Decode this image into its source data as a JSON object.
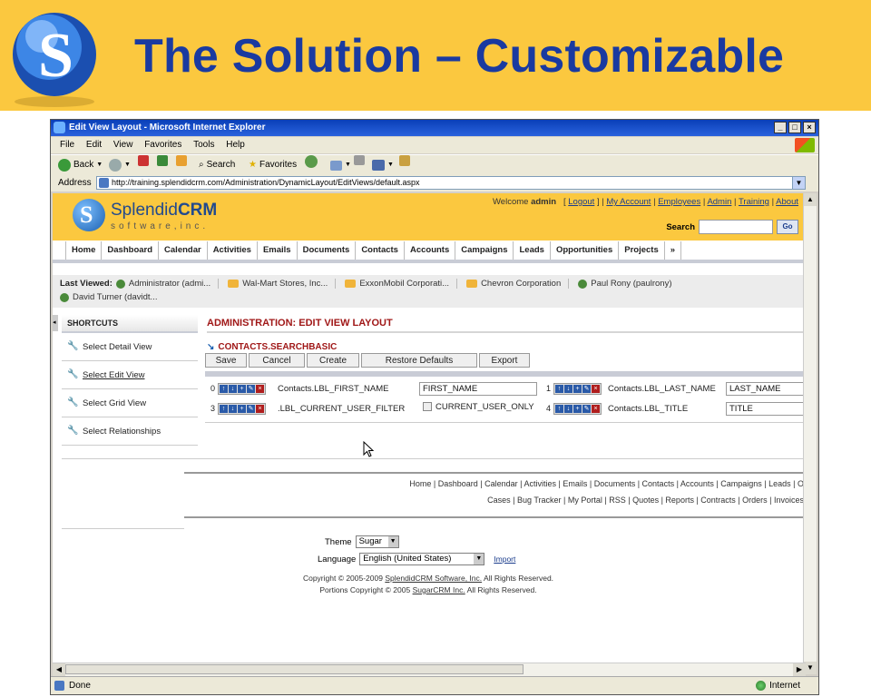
{
  "slide": {
    "title": "The Solution – Customizable"
  },
  "browser": {
    "window_title": "Edit View Layout - Microsoft Internet Explorer",
    "menu": [
      "File",
      "Edit",
      "View",
      "Favorites",
      "Tools",
      "Help"
    ],
    "toolbar": {
      "back": "Back",
      "search": "Search",
      "favorites": "Favorites"
    },
    "address_label": "Address",
    "url": "http://training.splendidcrm.com/Administration/DynamicLayout/EditViews/default.aspx",
    "status_text": "Done",
    "zone": "Internet"
  },
  "crm": {
    "brand_main": "Splendid",
    "brand_bold": "CRM",
    "brand_sub": "software,inc.",
    "welcome_prefix": "Welcome",
    "welcome_user": "admin",
    "top_links": [
      "Logout",
      "My Account",
      "Employees",
      "Admin",
      "Training",
      "About"
    ],
    "search_label": "Search",
    "search_go": "Go",
    "tabs": [
      "Home",
      "Dashboard",
      "Calendar",
      "Activities",
      "Emails",
      "Documents",
      "Contacts",
      "Accounts",
      "Campaigns",
      "Leads",
      "Opportunities",
      "Projects",
      "»"
    ],
    "last_viewed_label": "Last Viewed:",
    "last_viewed": [
      {
        "label": "Administrator (admi...",
        "icon": "user-icon"
      },
      {
        "label": "Wal-Mart Stores, Inc...",
        "icon": "folder-icon"
      },
      {
        "label": "ExxonMobil Corporati...",
        "icon": "folder-icon"
      },
      {
        "label": "Chevron Corporation",
        "icon": "folder-icon"
      },
      {
        "label": "Paul Rony (paulrony)",
        "icon": "user-icon"
      }
    ],
    "last_viewed_row2": "David Turner (davidt...",
    "shortcuts_title": "SHORTCUTS",
    "shortcuts": [
      "Select Detail View",
      "Select Edit View",
      "Select Grid View",
      "Select Relationships"
    ],
    "admin_title": "ADMINISTRATION: EDIT VIEW LAYOUT",
    "section_title": "CONTACTS.SEARCHBASIC",
    "buttons": [
      "Save",
      "Cancel",
      "Create",
      "Restore Defaults",
      "Export"
    ],
    "grid": [
      {
        "index": "0",
        "label": "Contacts.LBL_FIRST_NAME",
        "field": "FIRST_NAME"
      },
      {
        "index": "1",
        "label": "Contacts.LBL_LAST_NAME",
        "field": "LAST_NAME"
      },
      {
        "index": "3",
        "label": ".LBL_CURRENT_USER_FILTER",
        "field": "CURRENT_USER_ONLY"
      },
      {
        "index": "4",
        "label": "Contacts.LBL_TITLE",
        "field": "TITLE"
      }
    ],
    "footer_links_row1": "Home | Dashboard | Calendar | Activities | Emails | Documents | Contacts | Accounts | Campaigns | Leads | O",
    "footer_links_row2": "Cases | Bug Tracker | My Portal | RSS | Quotes | Reports | Contracts | Orders | Invoices",
    "theme_label": "Theme",
    "theme_value": "Sugar",
    "language_label": "Language",
    "language_value": "English (United States)",
    "import_label": "Import",
    "copyright_1_prefix": "Copyright © 2005-2009",
    "copyright_1_link": "SplendidCRM Software, Inc.",
    "copyright_1_suffix": "All Rights Reserved.",
    "copyright_2_prefix": "Portions Copyright © 2005",
    "copyright_2_link": "SugarCRM Inc.",
    "copyright_2_suffix": "All Rights Reserved."
  },
  "colors": {
    "slide_header_bg": "#fbc83f",
    "slide_title": "#1a3aa0",
    "crm_accent_red": "#a01818"
  }
}
